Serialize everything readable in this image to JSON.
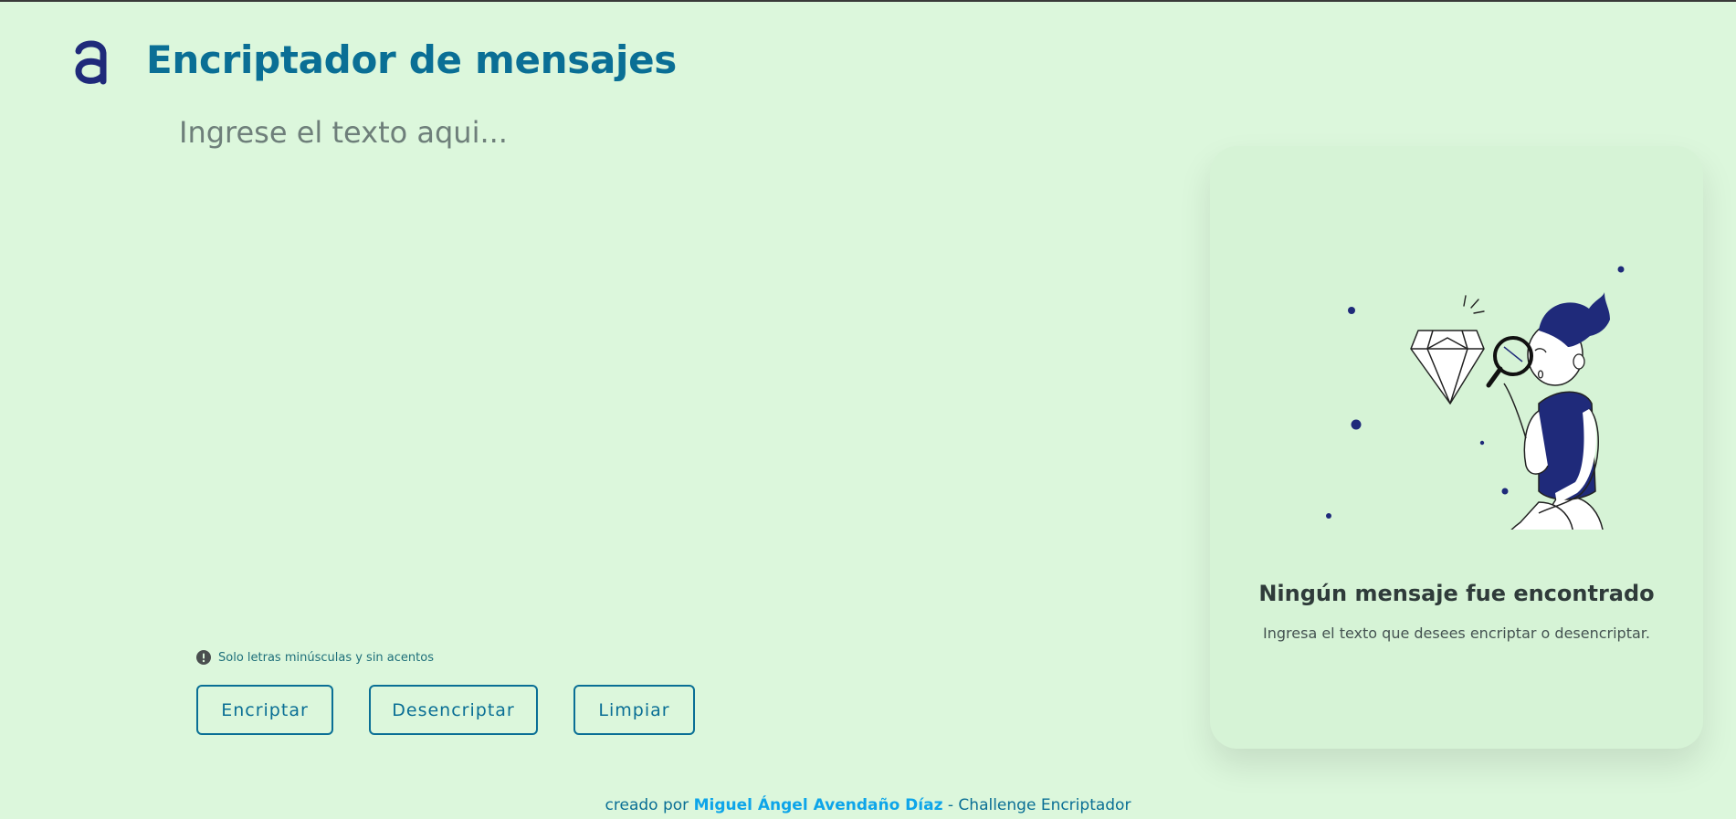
{
  "header": {
    "logo_icon": "alura-a-logo",
    "title": "Encriptador de mensajes"
  },
  "input": {
    "placeholder": "Ingrese el texto aqui...",
    "value": ""
  },
  "hint": {
    "icon": "exclamation-circle-icon",
    "text": "Solo letras minúsculas y sin acentos"
  },
  "buttons": {
    "encrypt": "Encriptar",
    "decrypt": "Desencriptar",
    "clear": "Limpiar"
  },
  "result": {
    "illustration": "person-inspecting-diamond-illustration",
    "title": "Ningún mensaje fue encontrado",
    "subtitle": "Ingresa el texto que desees encriptar o desencriptar."
  },
  "footer": {
    "prefix": "creado por ",
    "author": "Miguel Ángel Avendaño Díaz",
    "suffix": " - Challenge Encriptador"
  },
  "colors": {
    "background": "#dcf7dc",
    "accent": "#0a6f95",
    "logo": "#1f2a7a",
    "author_link": "#0ea5e9"
  }
}
